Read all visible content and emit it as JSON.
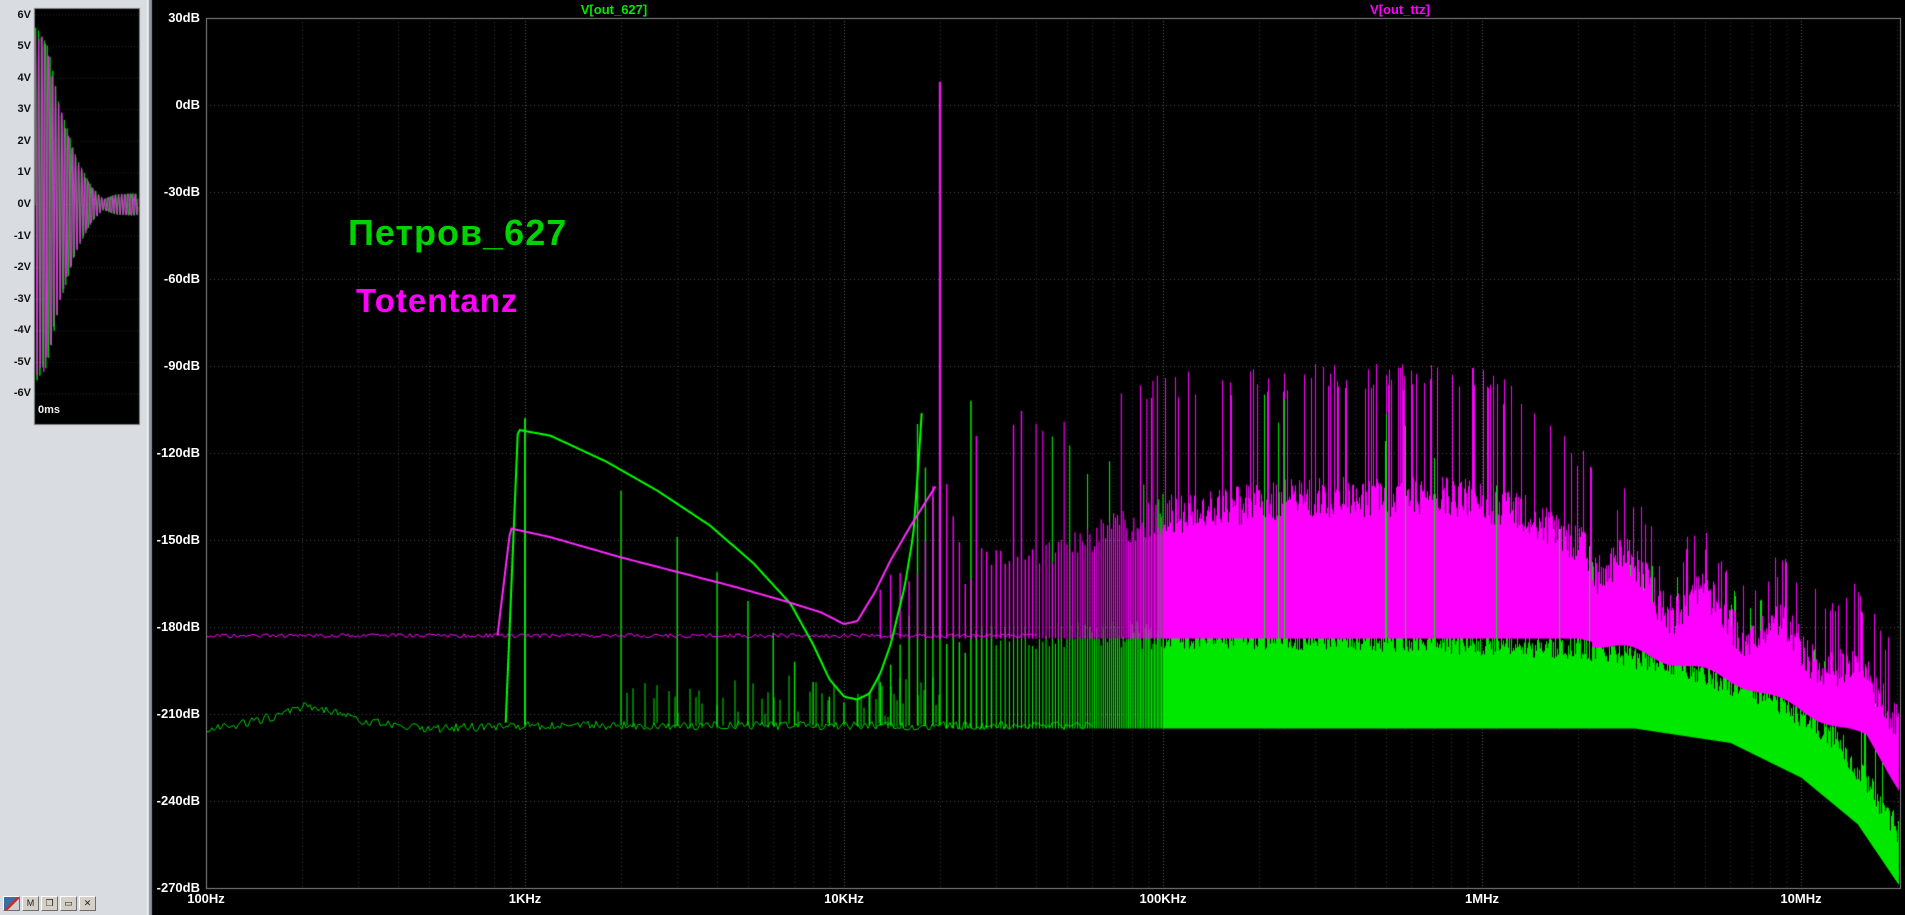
{
  "window": {
    "app": "waveform-viewer"
  },
  "left_panel": {
    "minimized_icons": [
      {
        "name": "app-logo-icon",
        "glyph": ""
      },
      {
        "name": "minimized-doc-icon",
        "glyph": "M"
      },
      {
        "name": "restore-icon",
        "glyph": "❐"
      },
      {
        "name": "maximize-icon",
        "glyph": "▭"
      },
      {
        "name": "close-icon",
        "glyph": "✕"
      }
    ]
  },
  "inset_chart": {
    "type": "line",
    "x_label": "0ms",
    "y_unit": "V",
    "y_tick_labels": [
      "6V",
      "5V",
      "4V",
      "3V",
      "2V",
      "1V",
      "0V",
      "-1V",
      "-2V",
      "-3V",
      "-4V",
      "-5V",
      "-6V"
    ],
    "envelope": "decaying-beating-sine",
    "traces": [
      {
        "color": "#00dc00",
        "cycles": 36,
        "amp_v": 5.6,
        "phase": 0
      },
      {
        "color": "#ff22ff",
        "cycles": 31,
        "amp_v": 5.4,
        "phase": 0.8
      }
    ]
  },
  "main_plot": {
    "trace_labels": [
      {
        "text": "V[out_627]",
        "color": "#00e800"
      },
      {
        "text": "V[out_ttz]",
        "color": "#ff00ff"
      }
    ],
    "annotations": [
      {
        "text": "Петров_627",
        "color": "#00d400"
      },
      {
        "text": "Totentanz",
        "color": "#ff00ff"
      }
    ]
  },
  "chart_data": {
    "type": "line",
    "subtype": "fft-spectrum",
    "grid": true,
    "x_axis": {
      "scale": "log",
      "unit": "Hz",
      "min": 100,
      "max": 20500000,
      "tick_labels": [
        "100Hz",
        "1KHz",
        "10KHz",
        "100KHz",
        "1MHz",
        "10MHz"
      ],
      "tick_freqs": [
        100,
        1000,
        10000,
        100000,
        1000000,
        10000000
      ]
    },
    "y_axis": {
      "unit": "dB",
      "min": -270,
      "max": 30,
      "step": 30,
      "tick_labels": [
        "30dB",
        "0dB",
        "-30dB",
        "-60dB",
        "-90dB",
        "-120dB",
        "-150dB",
        "-180dB",
        "-210dB",
        "-240dB",
        "-270dB"
      ]
    },
    "series": [
      {
        "name": "V[out_627]",
        "color": "#00e800",
        "noise_floor_db": -215,
        "fundamental_hz": 1000,
        "floor_line": [
          [
            100,
            -216
          ],
          [
            160,
            -211
          ],
          [
            210,
            -207
          ],
          [
            300,
            -212
          ],
          [
            500,
            -215
          ],
          [
            1000,
            -214
          ],
          [
            60000,
            -214
          ]
        ],
        "harmonic_peaks_db": [
          -108,
          -133,
          -149,
          -161,
          -171,
          -182,
          -192,
          -199,
          -204,
          -206,
          -205,
          -203,
          -199,
          -193,
          -186,
          -176,
          -110,
          -125,
          -135,
          -140
        ],
        "envelope_line": [
          [
            870,
            -213
          ],
          [
            950,
            -112
          ],
          [
            1200,
            -114
          ],
          [
            1800,
            -123
          ],
          [
            2600,
            -133
          ],
          [
            3800,
            -145
          ],
          [
            5200,
            -158
          ],
          [
            6800,
            -172
          ],
          [
            8000,
            -186
          ],
          [
            9000,
            -198
          ],
          [
            10000,
            -204
          ],
          [
            11000,
            -205
          ],
          [
            12000,
            -203
          ],
          [
            13000,
            -196
          ],
          [
            14000,
            -186
          ],
          [
            15500,
            -166
          ],
          [
            16500,
            -148
          ],
          [
            17200,
            -120
          ],
          [
            17600,
            -103
          ]
        ],
        "dense": {
          "from_hz": 21000,
          "tall_prob": 0.14,
          "floor": [
            [
              20000,
              -215
            ],
            [
              3000000,
              -215
            ],
            [
              6000000,
              -220
            ],
            [
              10000000,
              -232
            ],
            [
              15000000,
              -248
            ],
            [
              22000000,
              -275
            ]
          ],
          "base_top": [
            [
              20000,
              -186
            ],
            [
              60000,
              -184
            ],
            [
              400000,
              -185
            ],
            [
              2000000,
              -188
            ],
            [
              4000000,
              -194
            ],
            [
              8000000,
              -205
            ],
            [
              13000000,
              -220
            ],
            [
              22000000,
              -258
            ]
          ],
          "peak_top": [
            [
              20000,
              -102
            ],
            [
              30000,
              -106
            ],
            [
              50000,
              -118
            ],
            [
              100000,
              -138
            ],
            [
              300000,
              -152
            ],
            [
              1000000,
              -158
            ],
            [
              3000000,
              -158
            ],
            [
              6000000,
              -168
            ],
            [
              10000000,
              -182
            ],
            [
              22000000,
              -225
            ]
          ]
        },
        "overlay_peaks": [
          [
            100000,
            -120
          ],
          [
            200000,
            -105
          ],
          [
            500000,
            -110
          ],
          [
            1000000,
            -130
          ],
          [
            2000000,
            -150
          ]
        ]
      },
      {
        "name": "V[out_ttz]",
        "color": "#ff00ff",
        "flat_line_db": -183,
        "envelope_line": [
          [
            820,
            -183
          ],
          [
            900,
            -146
          ],
          [
            1200,
            -149
          ],
          [
            2000,
            -156
          ],
          [
            3000,
            -161
          ],
          [
            4500,
            -166
          ],
          [
            6500,
            -171
          ],
          [
            8500,
            -175
          ],
          [
            10000,
            -179
          ],
          [
            11000,
            -178
          ],
          [
            12500,
            -168
          ],
          [
            14000,
            -157
          ],
          [
            16000,
            -146
          ],
          [
            18000,
            -137
          ],
          [
            19500,
            -131
          ]
        ],
        "main_spike": {
          "freq_hz": 20000,
          "peak_db": 8
        },
        "sideband_tops_db": {
          "18": -150,
          "19": -132,
          "21": -130,
          "22": -142,
          "23": -152
        },
        "dense": {
          "from_hz": 13000,
          "tall_prob": 0.2,
          "floor": [
            [
              13000,
              -184
            ],
            [
              2000000,
              -184
            ],
            [
              4000000,
              -192
            ],
            [
              7000000,
              -201
            ],
            [
              11000000,
              -211
            ],
            [
              16000000,
              -218
            ],
            [
              22000000,
              -242
            ]
          ],
          "base_top": [
            [
              13000,
              -168
            ],
            [
              20000,
              -163
            ],
            [
              40000,
              -155
            ],
            [
              100000,
              -143
            ],
            [
              250000,
              -137
            ],
            [
              800000,
              -136
            ],
            [
              1500000,
              -144
            ],
            [
              2500000,
              -160
            ],
            [
              4000000,
              -172
            ],
            [
              6000000,
              -178
            ],
            [
              9000000,
              -186
            ],
            [
              14000000,
              -196
            ],
            [
              22000000,
              -214
            ]
          ],
          "peak_top": [
            [
              13000,
              -134
            ],
            [
              20000,
              -122
            ],
            [
              40000,
              -108
            ],
            [
              80000,
              -99
            ],
            [
              200000,
              -94
            ],
            [
              900000,
              -93
            ],
            [
              1400000,
              -102
            ],
            [
              2000000,
              -122
            ],
            [
              3000000,
              -146
            ],
            [
              4500000,
              -154
            ],
            [
              7000000,
              -160
            ],
            [
              10000000,
              -166
            ],
            [
              15000000,
              -172
            ],
            [
              22000000,
              -195
            ]
          ]
        }
      }
    ]
  }
}
